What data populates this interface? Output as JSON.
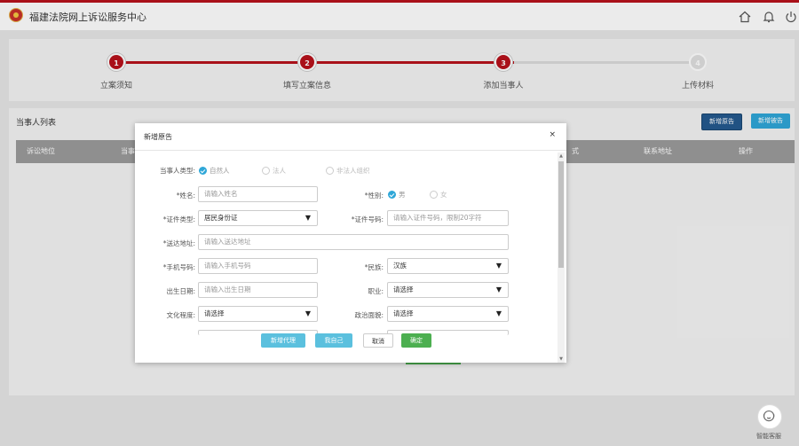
{
  "app": {
    "title": "福建法院网上诉讼服务中心"
  },
  "topbar": {
    "icons": [
      "home-icon",
      "bell-icon",
      "power-icon"
    ]
  },
  "steps": [
    {
      "number": "1",
      "label": "立案须知",
      "state": "done"
    },
    {
      "number": "2",
      "label": "填写立案信息",
      "state": "done"
    },
    {
      "number": "3",
      "label": "添加当事人",
      "state": "current"
    },
    {
      "number": "4",
      "label": "上传材料",
      "state": "pending"
    }
  ],
  "list": {
    "title": "当事人列表",
    "add_plaintiff_label": "新增原告",
    "add_defendant_label": "新增被告",
    "columns": [
      "诉讼地位",
      "当事",
      "式",
      "联系地址",
      "操作"
    ]
  },
  "modal": {
    "title": "新增原告",
    "close": "×",
    "party_type": {
      "label": "当事人类型:",
      "options": [
        "自然人",
        "法人",
        "非法人组织"
      ],
      "selected": "自然人"
    },
    "name": {
      "label": "*姓名:",
      "placeholder": "请输入姓名"
    },
    "gender": {
      "label": "*性别:",
      "options": [
        "男",
        "女"
      ],
      "selected": "男"
    },
    "id_type": {
      "label": "*证件类型:",
      "value": "居民身份证"
    },
    "id_number": {
      "label": "*证件号码:",
      "placeholder": "请输入证件号码，限制20字符"
    },
    "address": {
      "label": "*送达地址:",
      "placeholder": "请输入送达地址"
    },
    "phone": {
      "label": "*手机号码:",
      "placeholder": "请输入手机号码"
    },
    "ethnicity": {
      "label": "*民族:",
      "value": "汉族"
    },
    "birth_date": {
      "label": "出生日期:",
      "placeholder": "请输入出生日期"
    },
    "occupation": {
      "label": "职业:",
      "value": "请选择"
    },
    "education": {
      "label": "文化程度:",
      "value": "请选择"
    },
    "political": {
      "label": "政治面貌:",
      "value": "请选择"
    },
    "buttons": {
      "add_agent": "新增代理",
      "myself": "我自己",
      "cancel": "取消",
      "confirm": "确定"
    }
  },
  "assistant": {
    "label": "智能客服"
  },
  "colors": {
    "brand": "#b8121c",
    "primary": "#2fa7d8",
    "success": "#4caf50",
    "navy": "#245a8f"
  }
}
